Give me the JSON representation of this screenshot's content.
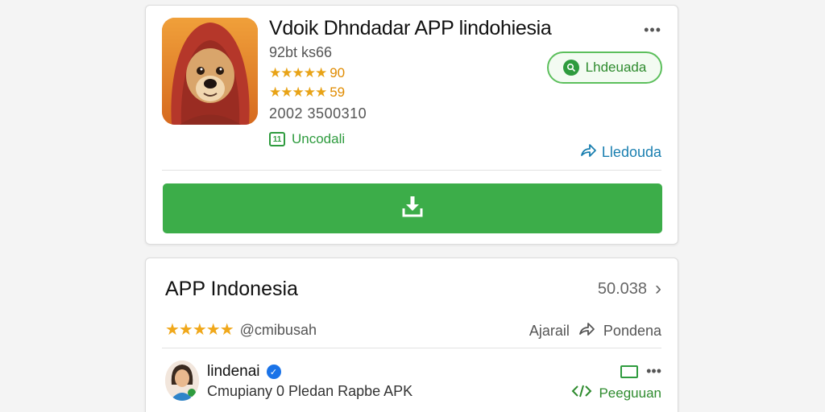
{
  "app": {
    "title": "Vdoik Dhndadar APP lindohiesia",
    "meta": "92bt ks66",
    "ratings": [
      {
        "stars": "★★★★★",
        "value": "90"
      },
      {
        "stars": "★★★★★",
        "value": "59"
      }
    ],
    "date": "2002 3500310",
    "badge_icon": "11",
    "badge_label": "Uncodali",
    "primary_action": "Lhdeuada",
    "share_label": "Lledouda",
    "more": "•••"
  },
  "section": {
    "title": "APP Indonesia",
    "count": "50.038",
    "chevron": "›",
    "stars": "★★★★★",
    "handle": "@cmibusah",
    "action_left": "Ajarail",
    "action_right": "Pondena"
  },
  "developer": {
    "name": "lindenai",
    "verified_mark": "✓",
    "description": "Cmupiany 0 Pledan Rapbe APK",
    "link_label": "Peeguuan",
    "more": "•••"
  },
  "colors": {
    "accent_green": "#3cad49",
    "link_blue": "#1a7fb0",
    "star_gold": "#f0a81b"
  }
}
